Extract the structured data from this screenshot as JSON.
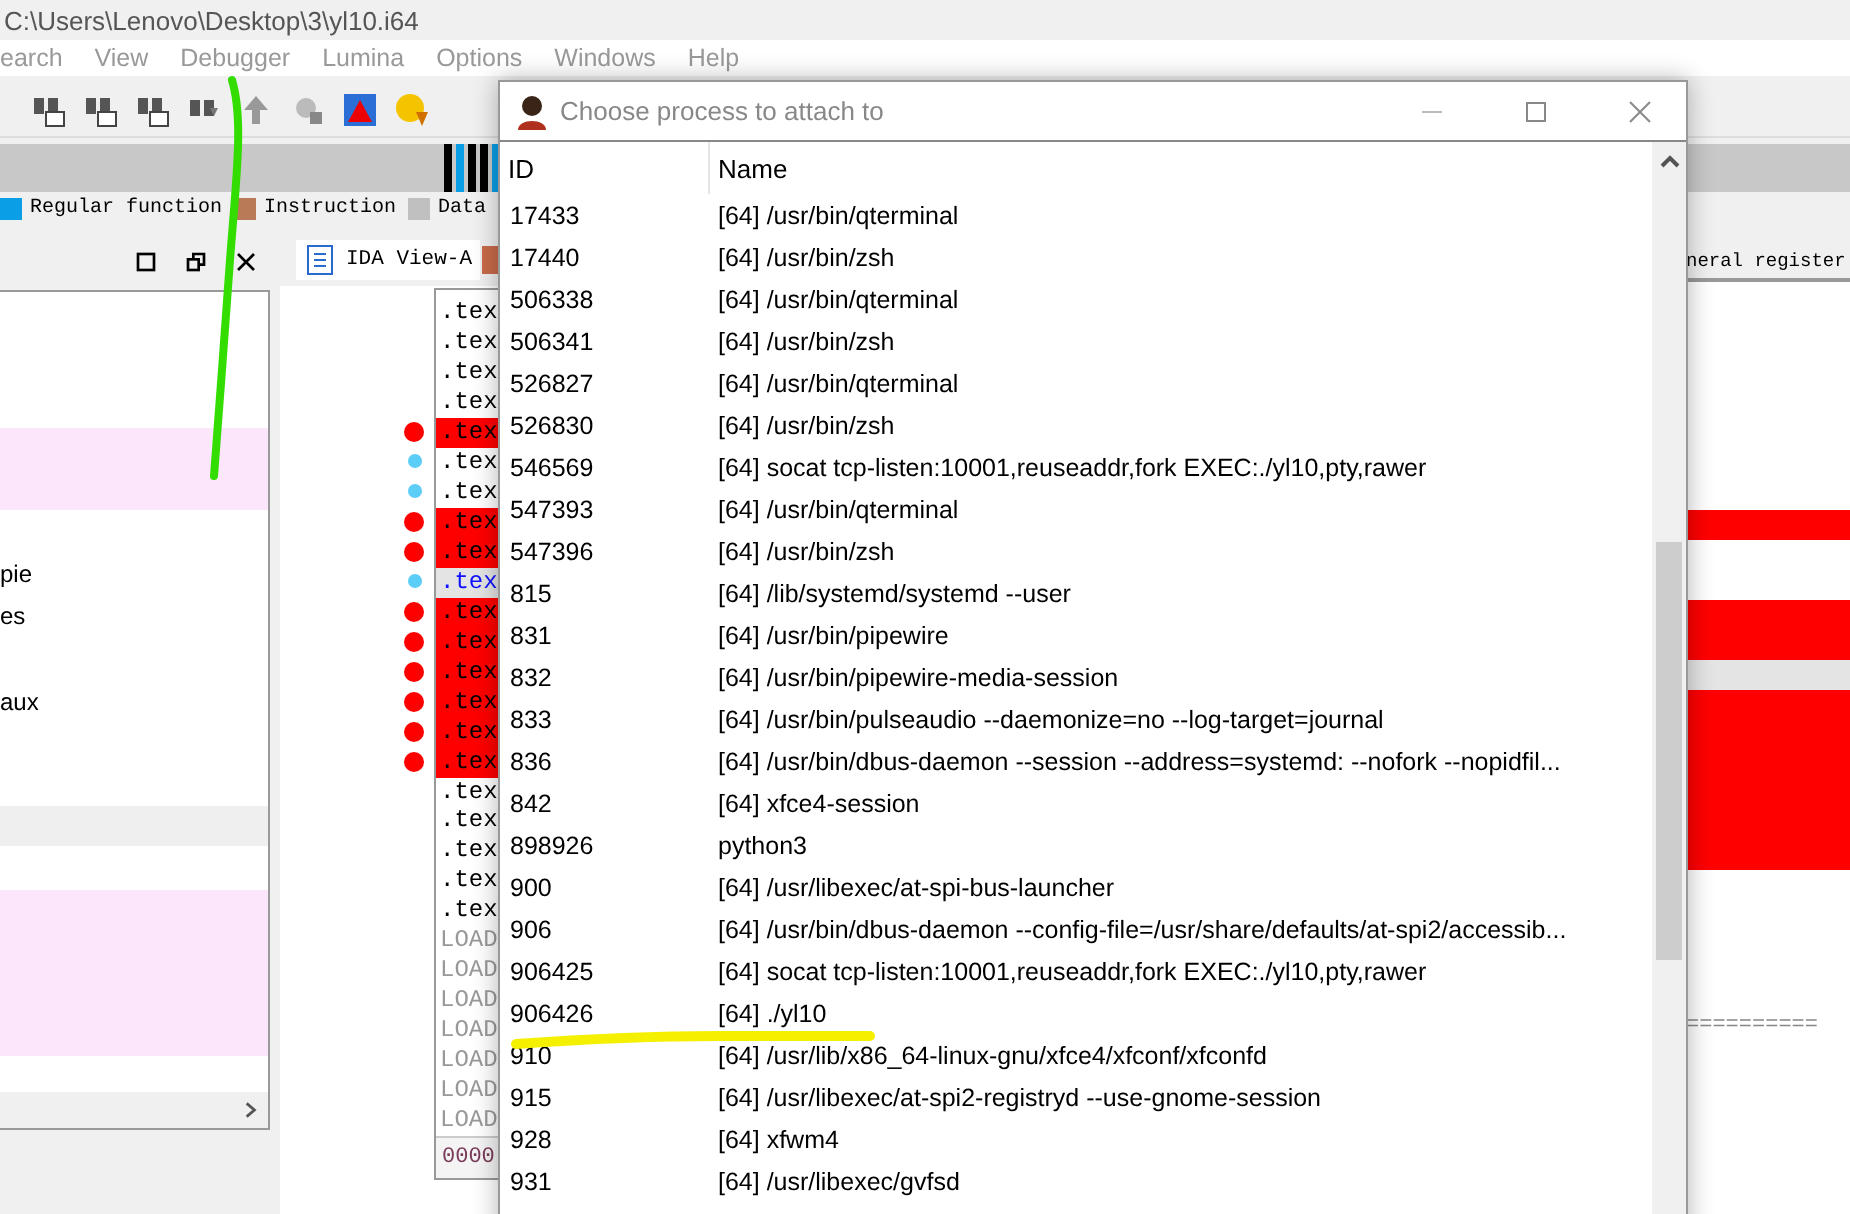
{
  "title": "C:\\Users\\Lenovo\\Desktop\\3\\yl10.i64",
  "menu": [
    "earch",
    "View",
    "Debugger",
    "Lumina",
    "Options",
    "Windows",
    "Help"
  ],
  "legend": [
    {
      "label": "Regular function",
      "color": "#0a9ee6"
    },
    {
      "label": "Instruction",
      "color": "#b97a57"
    },
    {
      "label": "Data",
      "color": "#c0c0c0"
    }
  ],
  "left_panel": {
    "lines": [
      "pie",
      "es",
      "aux"
    ]
  },
  "ida_view": {
    "tab": "IDA View-A",
    "rows": [
      {
        "text": ".tex",
        "kind": "plain"
      },
      {
        "text": ".tex",
        "kind": "plain"
      },
      {
        "text": ".tex",
        "kind": "plain"
      },
      {
        "text": ".tex",
        "kind": "plain"
      },
      {
        "text": ".tex",
        "kind": "breakpoint"
      },
      {
        "text": ".tex",
        "kind": "marked"
      },
      {
        "text": ".tex",
        "kind": "marked"
      },
      {
        "text": ".tex",
        "kind": "breakpoint"
      },
      {
        "text": ".tex",
        "kind": "breakpoint"
      },
      {
        "text": ".tex",
        "kind": "current"
      },
      {
        "text": ".tex",
        "kind": "breakpoint"
      },
      {
        "text": ".tex",
        "kind": "breakpoint"
      },
      {
        "text": ".tex",
        "kind": "breakpoint"
      },
      {
        "text": ".tex",
        "kind": "breakpoint"
      },
      {
        "text": ".tex",
        "kind": "breakpoint"
      },
      {
        "text": ".tex",
        "kind": "breakpoint"
      },
      {
        "text": ".tex",
        "kind": "plain"
      },
      {
        "text": ".tex",
        "kind": "plain"
      },
      {
        "text": ".tex",
        "kind": "plain"
      },
      {
        "text": ".tex",
        "kind": "plain"
      },
      {
        "text": ".tex",
        "kind": "plain"
      },
      {
        "text": "LOAD",
        "kind": "load"
      },
      {
        "text": "LOAD",
        "kind": "load"
      },
      {
        "text": "LOAD",
        "kind": "load"
      },
      {
        "text": "LOAD",
        "kind": "load"
      },
      {
        "text": "LOAD",
        "kind": "load"
      },
      {
        "text": "LOAD",
        "kind": "load"
      },
      {
        "text": "LOAD",
        "kind": "load"
      }
    ],
    "status": "0000"
  },
  "right_panel": {
    "tab": "neral register",
    "divider": "=========="
  },
  "dialog": {
    "title": "Choose process to attach to",
    "columns": [
      "ID",
      "Name"
    ],
    "rows": [
      {
        "id": "17433",
        "name": "[64] /usr/bin/qterminal"
      },
      {
        "id": "17440",
        "name": "[64] /usr/bin/zsh"
      },
      {
        "id": "506338",
        "name": "[64] /usr/bin/qterminal"
      },
      {
        "id": "506341",
        "name": "[64] /usr/bin/zsh"
      },
      {
        "id": "526827",
        "name": "[64] /usr/bin/qterminal"
      },
      {
        "id": "526830",
        "name": "[64] /usr/bin/zsh"
      },
      {
        "id": "546569",
        "name": "[64] socat tcp-listen:10001,reuseaddr,fork EXEC:./yl10,pty,rawer"
      },
      {
        "id": "547393",
        "name": "[64] /usr/bin/qterminal"
      },
      {
        "id": "547396",
        "name": "[64] /usr/bin/zsh"
      },
      {
        "id": "815",
        "name": "[64] /lib/systemd/systemd --user"
      },
      {
        "id": "831",
        "name": "[64] /usr/bin/pipewire"
      },
      {
        "id": "832",
        "name": "[64] /usr/bin/pipewire-media-session"
      },
      {
        "id": "833",
        "name": "[64] /usr/bin/pulseaudio --daemonize=no --log-target=journal"
      },
      {
        "id": "836",
        "name": "[64] /usr/bin/dbus-daemon --session --address=systemd: --nofork --nopidfil..."
      },
      {
        "id": "842",
        "name": "[64] xfce4-session"
      },
      {
        "id": "898926",
        "name": "python3"
      },
      {
        "id": "900",
        "name": "[64] /usr/libexec/at-spi-bus-launcher"
      },
      {
        "id": "906",
        "name": "[64] /usr/bin/dbus-daemon --config-file=/usr/share/defaults/at-spi2/accessib..."
      },
      {
        "id": "906425",
        "name": "[64] socat tcp-listen:10001,reuseaddr,fork EXEC:./yl10,pty,rawer"
      },
      {
        "id": "906426",
        "name": "[64] ./yl10"
      },
      {
        "id": "910",
        "name": "[64] /usr/lib/x86_64-linux-gnu/xfce4/xfconf/xfconfd"
      },
      {
        "id": "915",
        "name": "[64] /usr/libexec/at-spi2-registryd --use-gnome-session"
      },
      {
        "id": "928",
        "name": "[64] xfwm4"
      },
      {
        "id": "931",
        "name": "[64] /usr/libexec/gvfsd"
      }
    ]
  }
}
